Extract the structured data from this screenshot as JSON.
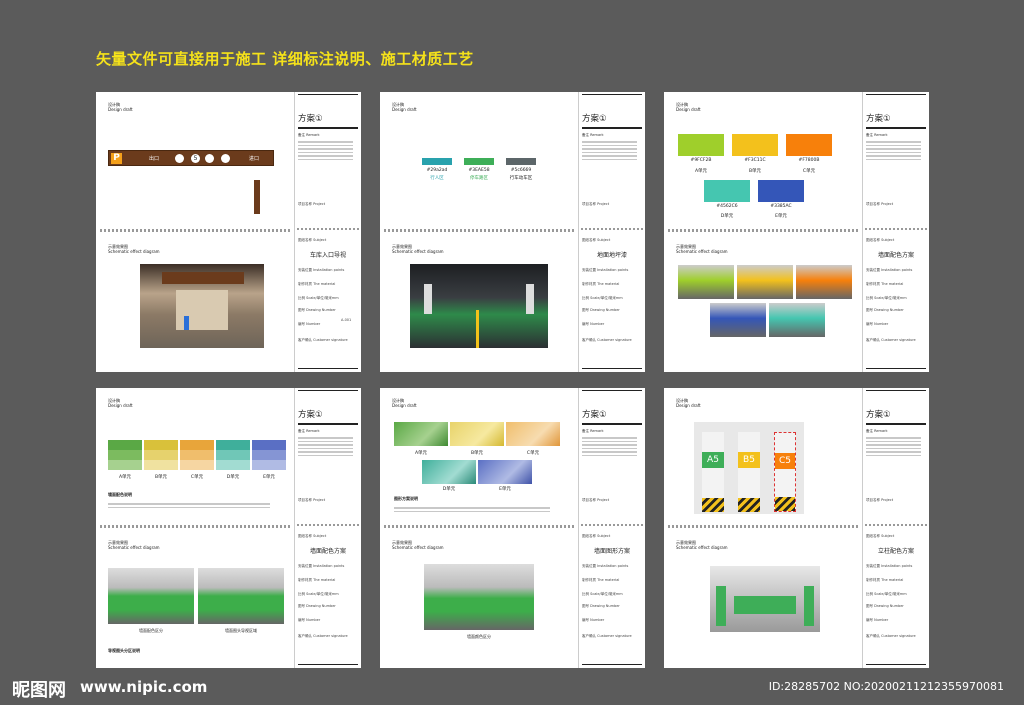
{
  "headline": "矢量文件可直接用于施工  详细标注说明、施工材质工艺",
  "common": {
    "design_draft_cn": "设计稿",
    "design_draft_en": "Design draft",
    "plan": "方案①",
    "remark": "备注 Remark",
    "project": "项目名称 Project",
    "subject": "图纸名称 Subject",
    "install": "安装位置 Installation points",
    "material": "制作材质 The material",
    "scale": "比例 Scale/单位/毫米mm",
    "drawing_no": "图号 Drawing Number",
    "number": "编号 Number",
    "signature": "客户确认 Customer signature",
    "schematic_cn": "示意效果图",
    "schematic_en": "Schematic effect diagram",
    "page_no": "A-001"
  },
  "sheets": [
    {
      "subject": "车库入口导视",
      "sign_texts": [
        "P",
        "出口",
        "5",
        "进口"
      ]
    },
    {
      "subject": "地面地坪漆",
      "swatches": [
        {
          "hex": "#29a2ad",
          "color": "#29a2ad",
          "label": "行人区"
        },
        {
          "hex": "#3EAE58",
          "color": "#3eae58",
          "label": "停车路区"
        },
        {
          "hex": "#5c6669",
          "color": "#5c6669",
          "label": "行车动车区"
        }
      ]
    },
    {
      "subject": "墙面配色方案",
      "units": [
        {
          "hex": "#9FCF2B",
          "color": "#9fcf2b",
          "label": "A单元"
        },
        {
          "hex": "#F3C11C",
          "color": "#f3c11c",
          "label": "B单元"
        },
        {
          "hex": "#F7800B",
          "color": "#f7800b",
          "label": "C单元"
        },
        {
          "hex": "#4562C6",
          "color": "#45c6b0",
          "label": "D单元"
        },
        {
          "hex": "#3385AC",
          "color": "#3456b8",
          "label": "E单元"
        }
      ]
    },
    {
      "subject": "墙面配色方案",
      "units": [
        "A单元",
        "B单元",
        "C单元",
        "D单元",
        "E单元"
      ],
      "note_title": "墙面配色说明",
      "photo_captions": [
        "墙面配色区分",
        "墙面图头导视区域"
      ],
      "bottom_note": "导视图头分区说明"
    },
    {
      "subject": "墙面图形方案",
      "units": [
        "A单元",
        "B单元",
        "C单元",
        "D单元",
        "E单元"
      ],
      "note_title": "图形方案说明",
      "photo_caption": "墙面颜色区分"
    },
    {
      "subject": "立柱配色方案",
      "pillars": [
        "A5",
        "B5",
        "C5"
      ]
    }
  ],
  "watermark": {
    "logo": "昵图网",
    "url": "www.nipic.com",
    "id": "ID:28285702 NO:20200211212355970081"
  }
}
